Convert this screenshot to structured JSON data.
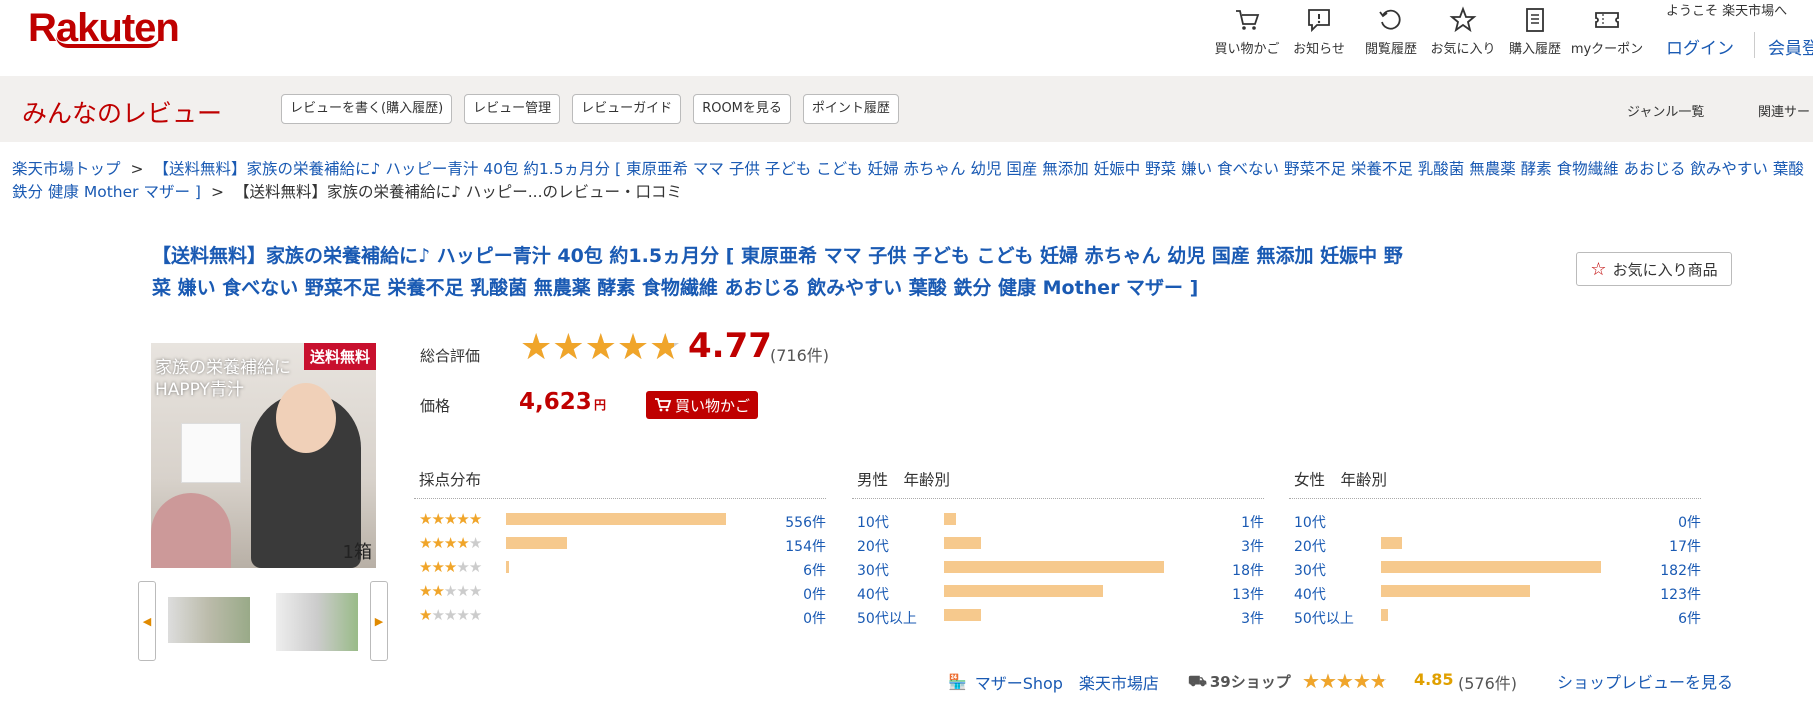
{
  "header": {
    "logo": "Rakuten",
    "nav": [
      {
        "label": "買い物かご",
        "icon": "cart-icon"
      },
      {
        "label": "お知らせ",
        "icon": "notification-icon"
      },
      {
        "label": "閲覧履歴",
        "icon": "history-icon"
      },
      {
        "label": "お気に入り",
        "icon": "star-icon"
      },
      {
        "label": "購入履歴",
        "icon": "receipt-icon"
      },
      {
        "label": "myクーポン",
        "icon": "coupon-icon"
      }
    ],
    "welcome": "ようこそ 楽天市場へ",
    "login": "ログイン",
    "member": "会員登"
  },
  "subheader": {
    "title": "みんなのレビュー",
    "buttons": [
      "レビューを書く(購入履歴)",
      "レビュー管理",
      "レビューガイド",
      "ROOMを見る",
      "ポイント履歴"
    ],
    "genre_link": "ジャンル一覧",
    "related_link": "関連サー"
  },
  "breadcrumb": {
    "home": "楽天市場トップ",
    "separator": ">",
    "product_link": "【送料無料】家族の栄養補給に♪ ハッピー青汁 40包 約1.5ヵ月分 [ 東原亜希 ママ 子供 子ども こども 妊婦 赤ちゃん 幼児 国産 無添加 妊娠中 野菜 嫌い 食べない 野菜不足 栄養不足 乳酸菌 無農薬 酵素 食物繊維 あおじる 飲みやすい 葉酸 鉄分 健康 Mother マザー ]",
    "current": "【送料無料】家族の栄養補給に♪ ハッピー...のレビュー・口コミ"
  },
  "product": {
    "title": "【送料無料】家族の栄養補給に♪ ハッピー青汁 40包 約1.5ヵ月分 [ 東原亜希 ママ 子供 子ども こども 妊婦 赤ちゃん 幼児 国産 無添加 妊娠中 野菜 嫌い 食べない 野菜不足 栄養不足 乳酸菌 無農薬 酵素 食物繊維 あおじる 飲みやすい 葉酸 鉄分 健康 Mother マザー ]",
    "favorite_label": "お気に入り商品",
    "image_tag": "送料無料",
    "image_caption_1": "家族の栄養補給に",
    "image_caption_2": "HAPPY青汁",
    "image_box": "1箱",
    "rating_label": "総合評価",
    "rating": 4.77,
    "rating_text": "4.77",
    "review_count": "(716件)",
    "price_label": "価格",
    "price": "4,623",
    "price_unit": "円",
    "cart_label": "買い物かご"
  },
  "distribution": {
    "score": {
      "title": "採点分布",
      "max": 556,
      "rows": [
        {
          "stars": 5,
          "count": 556,
          "count_label": "556件"
        },
        {
          "stars": 4,
          "count": 154,
          "count_label": "154件"
        },
        {
          "stars": 3,
          "count": 6,
          "count_label": "6件"
        },
        {
          "stars": 2,
          "count": 0,
          "count_label": "0件"
        },
        {
          "stars": 1,
          "count": 0,
          "count_label": "0件"
        }
      ]
    },
    "male": {
      "title": "男性　年齢別",
      "max": 18,
      "rows": [
        {
          "label": "10代",
          "count": 1,
          "count_label": "1件"
        },
        {
          "label": "20代",
          "count": 3,
          "count_label": "3件"
        },
        {
          "label": "30代",
          "count": 18,
          "count_label": "18件"
        },
        {
          "label": "40代",
          "count": 13,
          "count_label": "13件"
        },
        {
          "label": "50代以上",
          "count": 3,
          "count_label": "3件"
        }
      ]
    },
    "female": {
      "title": "女性　年齢別",
      "max": 182,
      "rows": [
        {
          "label": "10代",
          "count": 0,
          "count_label": "0件"
        },
        {
          "label": "20代",
          "count": 17,
          "count_label": "17件"
        },
        {
          "label": "30代",
          "count": 182,
          "count_label": "182件"
        },
        {
          "label": "40代",
          "count": 123,
          "count_label": "123件"
        },
        {
          "label": "50代以上",
          "count": 6,
          "count_label": "6件"
        }
      ]
    }
  },
  "shop": {
    "name": "マザーShop　楽天市場店",
    "points": "39ショップ",
    "rating": 4.85,
    "rating_text": "4.85",
    "review_count": "(576件)",
    "review_link": "ショップレビューを見る"
  },
  "colors": {
    "brand": "#bf0000",
    "link": "#1a5ab3",
    "star": "#f0a52a",
    "bar": "#f6c98d"
  }
}
